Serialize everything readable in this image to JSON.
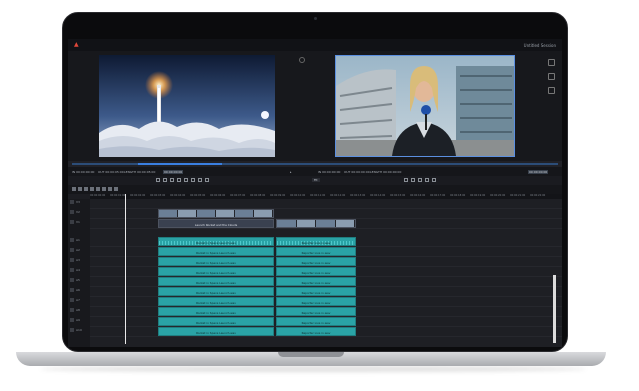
{
  "app": {
    "project_name": "Untitled Session",
    "accent": "#e0483a"
  },
  "viewers": {
    "source": {
      "icon": "rocket-launch-clouds"
    },
    "program": {
      "icon": "reporter-with-microphone"
    }
  },
  "infobar": {
    "src_in": "IN 00:00:00:00",
    "src_out": "OUT 00:00:05:00",
    "src_length": "LENGTH 00:00:05:00",
    "src_tc": "00:00:00:00",
    "prg_in": "IN 00:00:00:00",
    "prg_out": "OUT 00:00:00:00",
    "prg_length": "LENGTH 00:00:00:00",
    "prg_tc": "00:00:00:00"
  },
  "transport": {
    "zoom": "Fit"
  },
  "ruler": {
    "ticks": [
      "00:00:00:00",
      "00:00:01:00",
      "00:00:02:00",
      "00:00:03:00",
      "00:00:04:00",
      "00:00:05:00",
      "00:00:06:00",
      "00:00:07:00",
      "00:00:08:00",
      "00:00:09:00",
      "00:00:10:00",
      "00:00:11:00",
      "00:00:12:00",
      "00:00:13:00",
      "00:00:14:00",
      "00:00:15:00",
      "00:00:16:00",
      "00:00:17:00",
      "00:00:18:00",
      "00:00:19:00",
      "00:00:20:00",
      "00:00:21:00",
      "00:00:22:00"
    ]
  },
  "track_headers": [
    {
      "name": "V3"
    },
    {
      "name": "V2"
    },
    {
      "name": "V1"
    },
    {
      "name": "A1"
    },
    {
      "name": "A2"
    },
    {
      "name": "A3"
    },
    {
      "name": "A4"
    },
    {
      "name": "A5"
    },
    {
      "name": "A6"
    },
    {
      "name": "A7"
    },
    {
      "name": "A8"
    },
    {
      "name": "A9"
    },
    {
      "name": "A10"
    }
  ],
  "clips": {
    "video_title": "Launch Rocket and the Clouds",
    "audio_left": "Rocket in Space Launch.wav",
    "audio_right": "Reporter Live in.wav"
  }
}
